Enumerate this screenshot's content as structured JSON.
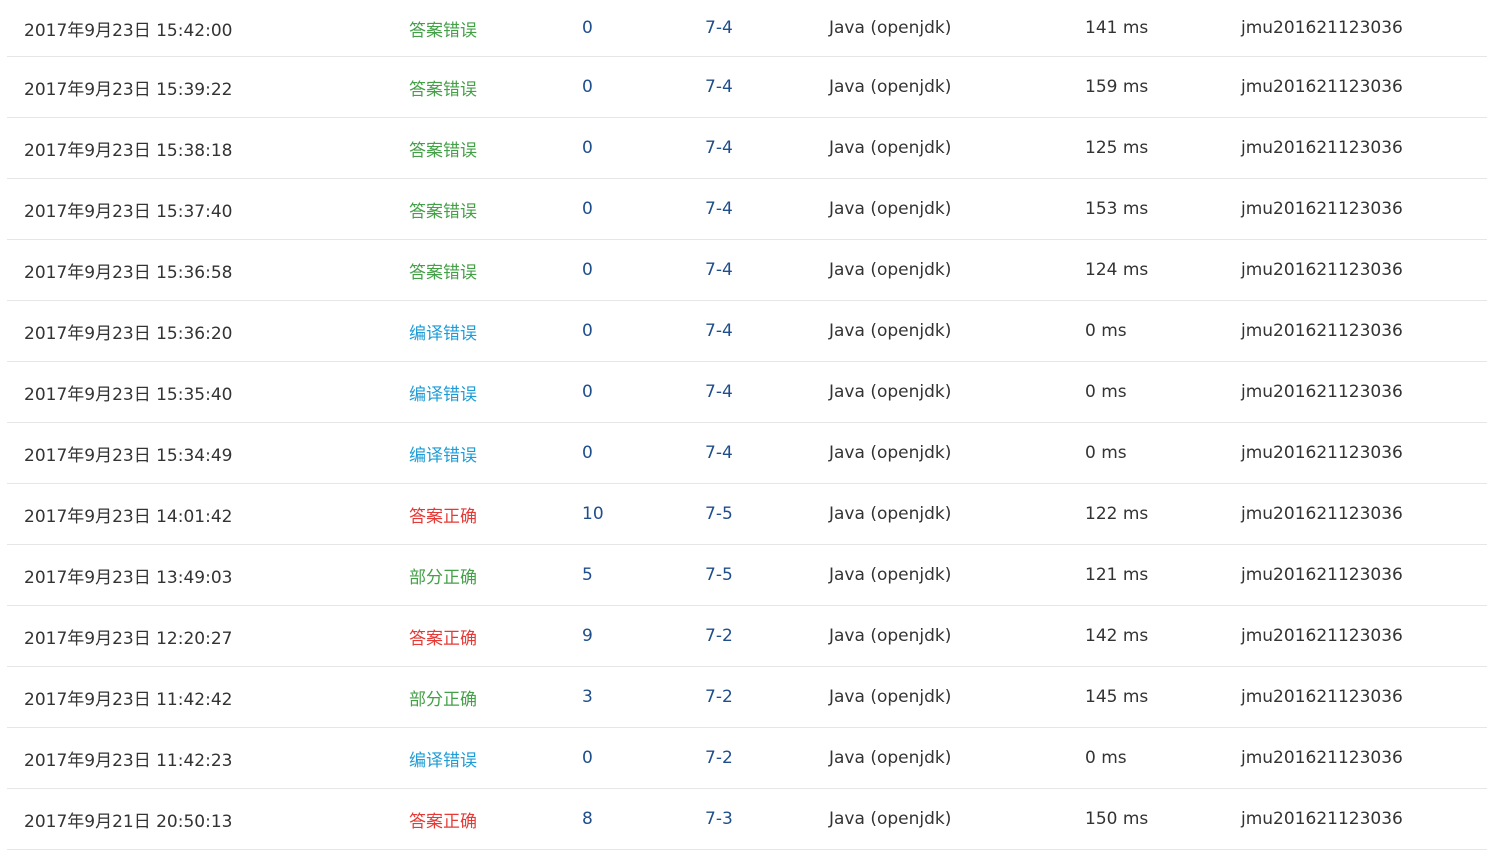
{
  "colors": {
    "wrong_answer": "#43a047",
    "compile_error": "#1e9cd7",
    "accepted": "#e53935",
    "partial": "#43a047",
    "link": "#1f4e8c",
    "text": "#333333"
  },
  "submissions": [
    {
      "time": "2017年9月23日 15:42:00",
      "status": "答案错误",
      "status_type": "wrong_answer",
      "score": "0",
      "problem": "7-4",
      "language": "Java (openjdk)",
      "runtime": "141 ms",
      "user": "jmu201621123036"
    },
    {
      "time": "2017年9月23日 15:39:22",
      "status": "答案错误",
      "status_type": "wrong_answer",
      "score": "0",
      "problem": "7-4",
      "language": "Java (openjdk)",
      "runtime": "159 ms",
      "user": "jmu201621123036"
    },
    {
      "time": "2017年9月23日 15:38:18",
      "status": "答案错误",
      "status_type": "wrong_answer",
      "score": "0",
      "problem": "7-4",
      "language": "Java (openjdk)",
      "runtime": "125 ms",
      "user": "jmu201621123036"
    },
    {
      "time": "2017年9月23日 15:37:40",
      "status": "答案错误",
      "status_type": "wrong_answer",
      "score": "0",
      "problem": "7-4",
      "language": "Java (openjdk)",
      "runtime": "153 ms",
      "user": "jmu201621123036"
    },
    {
      "time": "2017年9月23日 15:36:58",
      "status": "答案错误",
      "status_type": "wrong_answer",
      "score": "0",
      "problem": "7-4",
      "language": "Java (openjdk)",
      "runtime": "124 ms",
      "user": "jmu201621123036"
    },
    {
      "time": "2017年9月23日 15:36:20",
      "status": "编译错误",
      "status_type": "compile_error",
      "score": "0",
      "problem": "7-4",
      "language": "Java (openjdk)",
      "runtime": "0 ms",
      "user": "jmu201621123036"
    },
    {
      "time": "2017年9月23日 15:35:40",
      "status": "编译错误",
      "status_type": "compile_error",
      "score": "0",
      "problem": "7-4",
      "language": "Java (openjdk)",
      "runtime": "0 ms",
      "user": "jmu201621123036"
    },
    {
      "time": "2017年9月23日 15:34:49",
      "status": "编译错误",
      "status_type": "compile_error",
      "score": "0",
      "problem": "7-4",
      "language": "Java (openjdk)",
      "runtime": "0 ms",
      "user": "jmu201621123036"
    },
    {
      "time": "2017年9月23日 14:01:42",
      "status": "答案正确",
      "status_type": "accepted",
      "score": "10",
      "problem": "7-5",
      "language": "Java (openjdk)",
      "runtime": "122 ms",
      "user": "jmu201621123036"
    },
    {
      "time": "2017年9月23日 13:49:03",
      "status": "部分正确",
      "status_type": "partial",
      "score": "5",
      "problem": "7-5",
      "language": "Java (openjdk)",
      "runtime": "121 ms",
      "user": "jmu201621123036"
    },
    {
      "time": "2017年9月23日 12:20:27",
      "status": "答案正确",
      "status_type": "accepted",
      "score": "9",
      "problem": "7-2",
      "language": "Java (openjdk)",
      "runtime": "142 ms",
      "user": "jmu201621123036"
    },
    {
      "time": "2017年9月23日 11:42:42",
      "status": "部分正确",
      "status_type": "partial",
      "score": "3",
      "problem": "7-2",
      "language": "Java (openjdk)",
      "runtime": "145 ms",
      "user": "jmu201621123036"
    },
    {
      "time": "2017年9月23日 11:42:23",
      "status": "编译错误",
      "status_type": "compile_error",
      "score": "0",
      "problem": "7-2",
      "language": "Java (openjdk)",
      "runtime": "0 ms",
      "user": "jmu201621123036"
    },
    {
      "time": "2017年9月21日 20:50:13",
      "status": "答案正确",
      "status_type": "accepted",
      "score": "8",
      "problem": "7-3",
      "language": "Java (openjdk)",
      "runtime": "150 ms",
      "user": "jmu201621123036"
    }
  ]
}
